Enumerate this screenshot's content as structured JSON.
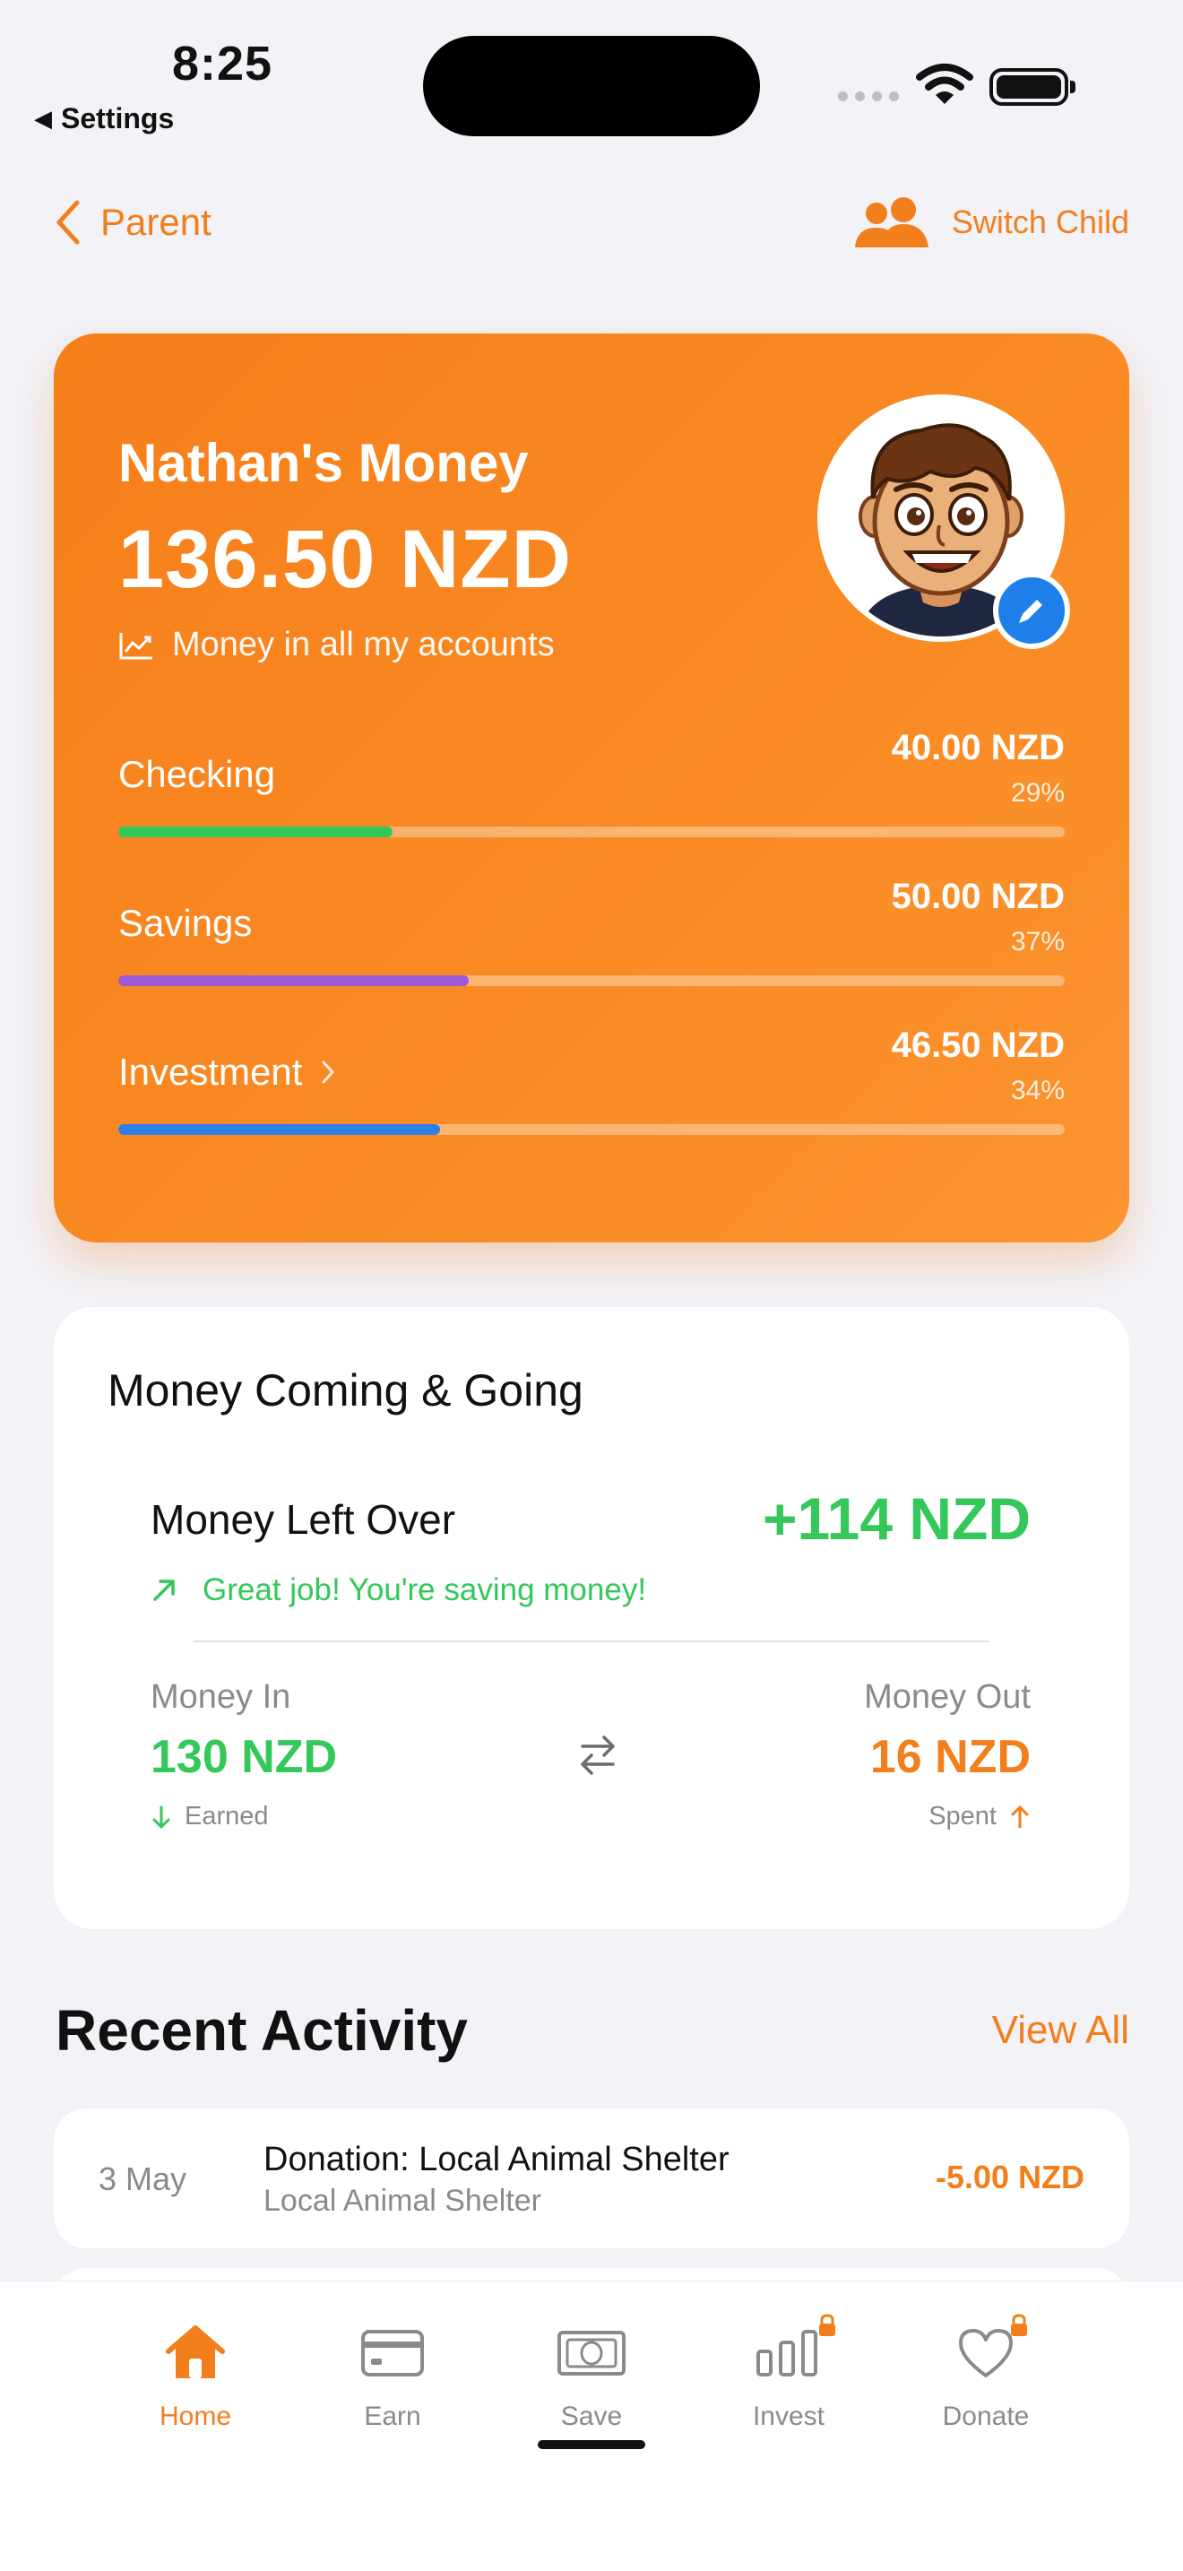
{
  "status_bar": {
    "time": "8:25",
    "back_app": "Settings"
  },
  "nav": {
    "back_label": "Parent",
    "switch_label": "Switch Child"
  },
  "hero": {
    "name": "Nathan's Money",
    "total": "136.50 NZD",
    "subtitle": "Money in all my accounts",
    "accounts": [
      {
        "label": "Checking",
        "amount": "40.00 NZD",
        "percent": "29%",
        "fraction": 0.29,
        "color": "#34C759",
        "has_chevron": false
      },
      {
        "label": "Savings",
        "amount": "50.00 NZD",
        "percent": "37%",
        "fraction": 0.37,
        "color": "#9B59D6",
        "has_chevron": false
      },
      {
        "label": "Investment",
        "amount": "46.50 NZD",
        "percent": "34%",
        "fraction": 0.34,
        "color": "#2F7FE8",
        "has_chevron": true
      }
    ]
  },
  "flow": {
    "title": "Money Coming & Going",
    "left_over_label": "Money Left Over",
    "left_over_value": "+114 NZD",
    "message": "Great job! You're saving money!",
    "in_label": "Money In",
    "in_value": "130 NZD",
    "in_sub": "Earned",
    "out_label": "Money Out",
    "out_value": "16 NZD",
    "out_sub": "Spent"
  },
  "activity": {
    "title": "Recent Activity",
    "view_all": "View All",
    "items": [
      {
        "date": "3 May",
        "title": "Donation: Local Animal Shelter",
        "subtitle": "Local Animal Shelter",
        "amount": "-5.00 NZD"
      }
    ]
  },
  "tabs": [
    {
      "label": "Home",
      "icon": "house-icon",
      "active": true,
      "locked": false
    },
    {
      "label": "Earn",
      "icon": "card-icon",
      "active": false,
      "locked": false
    },
    {
      "label": "Save",
      "icon": "banknote-icon",
      "active": false,
      "locked": false
    },
    {
      "label": "Invest",
      "icon": "bar-chart-icon",
      "active": false,
      "locked": true
    },
    {
      "label": "Donate",
      "icon": "heart-icon",
      "active": false,
      "locked": true
    }
  ],
  "colors": {
    "accent": "#F27E1C",
    "positive": "#34C759",
    "edit_badge": "#1E7FEA"
  }
}
